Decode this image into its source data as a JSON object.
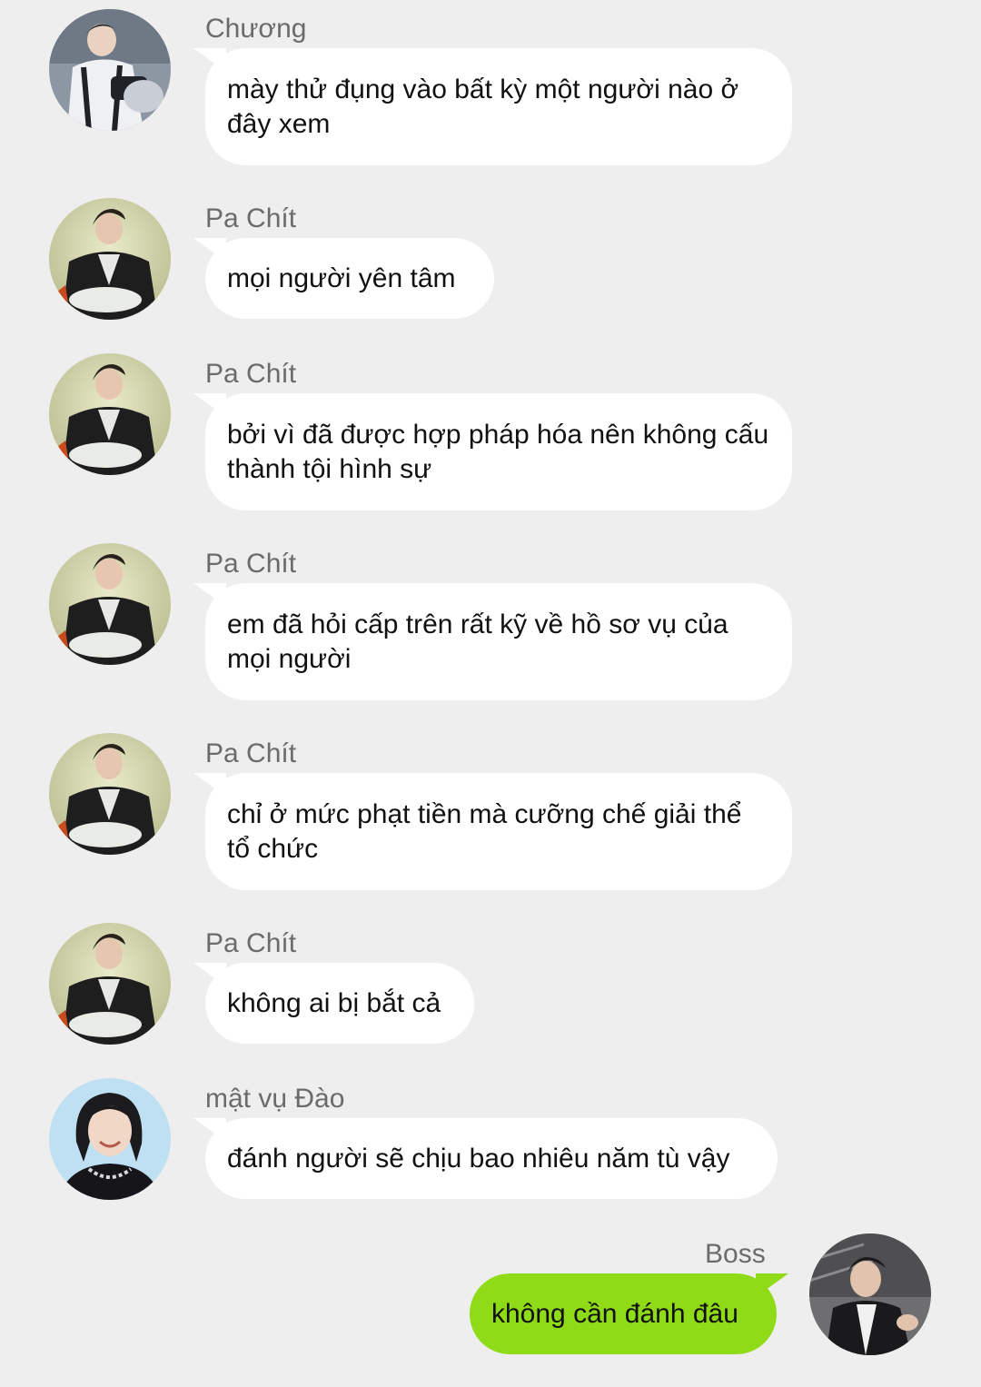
{
  "messages": [
    {
      "sender": "Chương",
      "avatar": "chuong-avatar",
      "text": "mày thử đụng vào bất kỳ một người nào ở đây xem"
    },
    {
      "sender": "Pa Chít",
      "avatar": "pa-chit-avatar",
      "text": "mọi người yên tâm"
    },
    {
      "sender": "Pa Chít",
      "avatar": "pa-chit-avatar",
      "text": "bởi vì đã được hợp pháp hóa nên không cấu thành tội hình sự"
    },
    {
      "sender": "Pa Chít",
      "avatar": "pa-chit-avatar",
      "text": "em đã hỏi cấp trên rất kỹ về hồ sơ vụ của mọi người"
    },
    {
      "sender": "Pa Chít",
      "avatar": "pa-chit-avatar",
      "text": "chỉ ở mức phạt tiền mà cưỡng chế giải thể tổ chức"
    },
    {
      "sender": "Pa Chít",
      "avatar": "pa-chit-avatar",
      "text": "không ai bị bắt cả"
    },
    {
      "sender": "mật vụ Đào",
      "avatar": "mat-vu-dao-avatar",
      "text": "đánh người sẽ chịu bao nhiêu năm tù vậy"
    },
    {
      "sender": "Boss",
      "avatar": "boss-avatar",
      "text": "không cần đánh đâu",
      "outgoing": true
    }
  ],
  "colors": {
    "background": "#eeeeee",
    "incoming_bubble": "#ffffff",
    "outgoing_bubble": "#8fdb17",
    "sender_name": "#6b6b6b",
    "message_text": "#111111"
  }
}
